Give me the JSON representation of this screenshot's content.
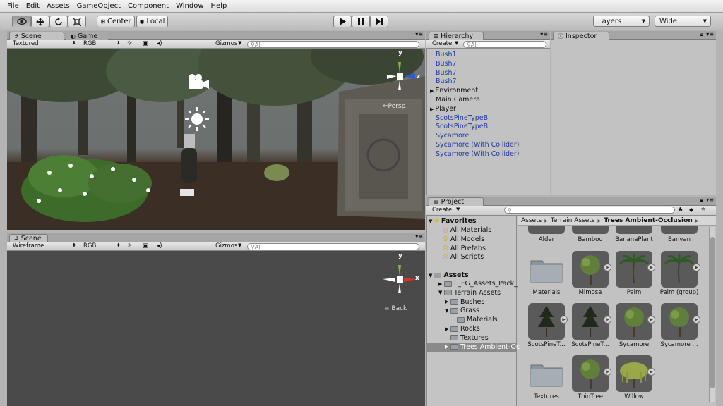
{
  "menu": [
    "File",
    "Edit",
    "Assets",
    "GameObject",
    "Component",
    "Window",
    "Help"
  ],
  "toolbar": {
    "tool_icons": [
      "eye-icon",
      "move-icon",
      "rotate-icon",
      "scale-icon"
    ],
    "pivot": "Center",
    "space": "Local",
    "layers": "Layers",
    "layout": "Wide"
  },
  "scene_top": {
    "tab_scene": "Scene",
    "tab_game": "Game",
    "render_mode": "Textured",
    "color_mode": "RGB",
    "gizmos": "Gizmos",
    "search_placeholder": "All",
    "view_label": "Persp",
    "axis_y": "y",
    "axis_z": "z"
  },
  "scene_bottom": {
    "tab_scene": "Scene",
    "render_mode": "Wireframe",
    "color_mode": "RGB",
    "gizmos": "Gizmos",
    "search_placeholder": "All",
    "view_label": "Back",
    "axis_y": "y",
    "axis_x": "x"
  },
  "hierarchy": {
    "tab": "Hierarchy",
    "create": "Create",
    "search_placeholder": "All",
    "items": [
      {
        "label": "Bush1",
        "prefab": true
      },
      {
        "label": "Bush7",
        "prefab": true
      },
      {
        "label": "Bush7",
        "prefab": true
      },
      {
        "label": "Bush7",
        "prefab": true
      },
      {
        "label": "Environment",
        "prefab": false,
        "expandable": true
      },
      {
        "label": "Main Camera",
        "prefab": false
      },
      {
        "label": "Player",
        "prefab": false,
        "expandable": true
      },
      {
        "label": "ScotsPineTypeB",
        "prefab": true
      },
      {
        "label": "ScotsPineTypeB",
        "prefab": true
      },
      {
        "label": "Sycamore",
        "prefab": true
      },
      {
        "label": "Sycamore (With Collider)",
        "prefab": true
      },
      {
        "label": "Sycamore (With Collider)",
        "prefab": true
      }
    ]
  },
  "inspector": {
    "tab": "Inspector"
  },
  "project": {
    "tab": "Project",
    "create": "Create",
    "favorites": {
      "label": "Favorites",
      "items": [
        "All Materials",
        "All Models",
        "All Prefabs",
        "All Scripts"
      ]
    },
    "assets": {
      "label": "Assets",
      "items": [
        {
          "label": "L_FG_Assets_Pack_",
          "indent": 1,
          "arrow": "right"
        },
        {
          "label": "Terrain Assets",
          "indent": 1,
          "arrow": "down"
        },
        {
          "label": "Bushes",
          "indent": 2,
          "arrow": "right"
        },
        {
          "label": "Grass",
          "indent": 2,
          "arrow": "down"
        },
        {
          "label": "Materials",
          "indent": 3,
          "arrow": ""
        },
        {
          "label": "Rocks",
          "indent": 2,
          "arrow": "right"
        },
        {
          "label": "Textures",
          "indent": 2,
          "arrow": ""
        },
        {
          "label": "Trees Ambient-Oc",
          "indent": 2,
          "arrow": "right",
          "selected": true
        }
      ]
    },
    "breadcrumb": [
      "Assets",
      "Terrain Assets",
      "Trees Ambient-Occlusion"
    ],
    "grid_top_row": [
      "Alder",
      "Bamboo",
      "BananaPlant",
      "Banyan"
    ],
    "grid": [
      {
        "label": "Materials",
        "kind": "folder"
      },
      {
        "label": "Mimosa",
        "kind": "tree"
      },
      {
        "label": "Palm",
        "kind": "palm"
      },
      {
        "label": "Palm (group)",
        "kind": "palm"
      },
      {
        "label": "ScotsPineT...",
        "kind": "pine"
      },
      {
        "label": "ScotsPineT...",
        "kind": "pine"
      },
      {
        "label": "Sycamore",
        "kind": "tree"
      },
      {
        "label": "Sycamore ...",
        "kind": "tree"
      },
      {
        "label": "Textures",
        "kind": "folder"
      },
      {
        "label": "ThinTree",
        "kind": "tree"
      },
      {
        "label": "Willow",
        "kind": "willow"
      }
    ]
  },
  "colors": {
    "prefab_text": "#1e3fa0",
    "selection": "#8a8a8a",
    "scene_bg": "#6f7371",
    "axis_y": "#7ac52b",
    "axis_x": "#d9341f",
    "axis_z": "#2a5ad8"
  }
}
